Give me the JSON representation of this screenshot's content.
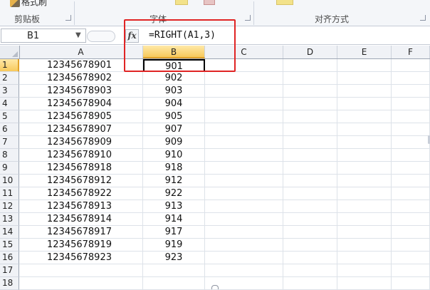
{
  "ribbon": {
    "format_painter": "格式刷",
    "groups": [
      {
        "label": "剪贴板"
      },
      {
        "label": "字体"
      },
      {
        "label": "对齐方式"
      }
    ]
  },
  "formula_bar": {
    "name_box": "B1",
    "fx_label": "fx",
    "formula": "=RIGHT(A1,3)"
  },
  "columns": [
    "A",
    "B",
    "C",
    "D",
    "E",
    "F"
  ],
  "active_column": "B",
  "rows": [
    {
      "num": "1",
      "a": "12345678901",
      "b": "901"
    },
    {
      "num": "2",
      "a": "12345678902",
      "b": "902"
    },
    {
      "num": "3",
      "a": "12345678903",
      "b": "903"
    },
    {
      "num": "4",
      "a": "12345678904",
      "b": "904"
    },
    {
      "num": "5",
      "a": "12345678905",
      "b": "905"
    },
    {
      "num": "6",
      "a": "12345678907",
      "b": "907"
    },
    {
      "num": "7",
      "a": "12345678909",
      "b": "909"
    },
    {
      "num": "8",
      "a": "12345678910",
      "b": "910"
    },
    {
      "num": "9",
      "a": "12345678918",
      "b": "918"
    },
    {
      "num": "10",
      "a": "12345678912",
      "b": "912"
    },
    {
      "num": "11",
      "a": "12345678922",
      "b": "922"
    },
    {
      "num": "12",
      "a": "12345678913",
      "b": "913"
    },
    {
      "num": "13",
      "a": "12345678914",
      "b": "914"
    },
    {
      "num": "14",
      "a": "12345678917",
      "b": "917"
    },
    {
      "num": "15",
      "a": "12345678919",
      "b": "919"
    },
    {
      "num": "16",
      "a": "12345678923",
      "b": "923"
    },
    {
      "num": "17",
      "a": "",
      "b": ""
    },
    {
      "num": "18",
      "a": "",
      "b": ""
    }
  ],
  "colors": {
    "highlight": "#e02424",
    "active_header": "#f7c95c"
  }
}
